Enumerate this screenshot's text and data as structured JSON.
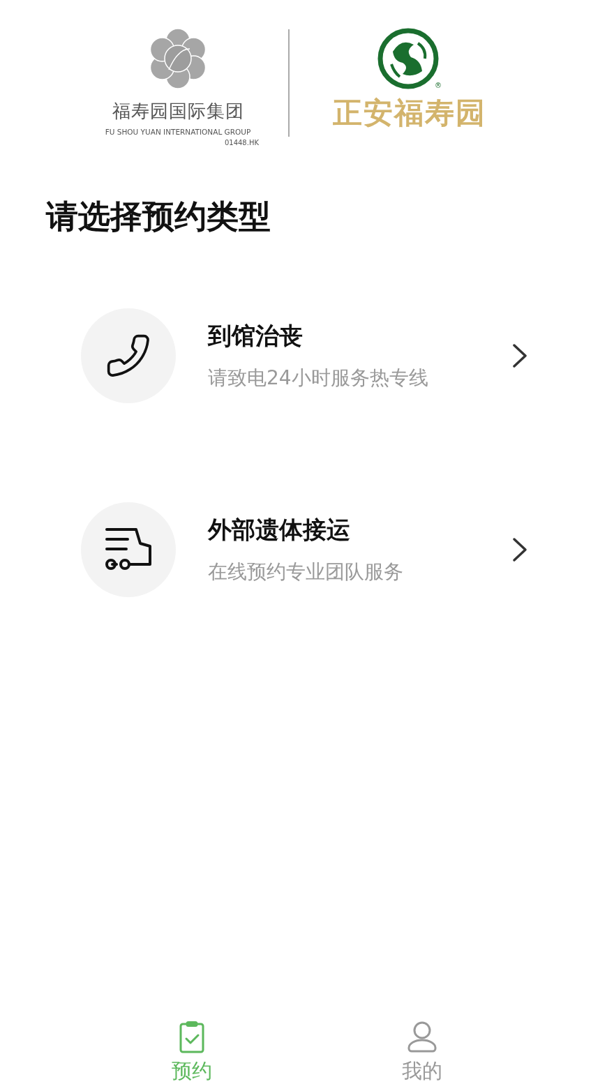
{
  "header": {
    "group_logo": {
      "name": "福寿园国际集团",
      "english": "FU SHOU YUAN INTERNATIONAL GROUP",
      "code": "01448.HK"
    },
    "brand_logo": {
      "mark": "®",
      "name": "正安福寿园"
    }
  },
  "heading": "请选择预约类型",
  "options": [
    {
      "kind": "phone",
      "title": "到馆治丧",
      "subtitle": "请致电24小时服务热专线"
    },
    {
      "kind": "truck",
      "title": "外部遗体接运",
      "subtitle": "在线预约专业团队服务"
    }
  ],
  "tab_bar": [
    {
      "kind": "clipboard",
      "label": "预约",
      "selected": true
    },
    {
      "kind": "user",
      "label": "我的",
      "selected": false
    }
  ]
}
